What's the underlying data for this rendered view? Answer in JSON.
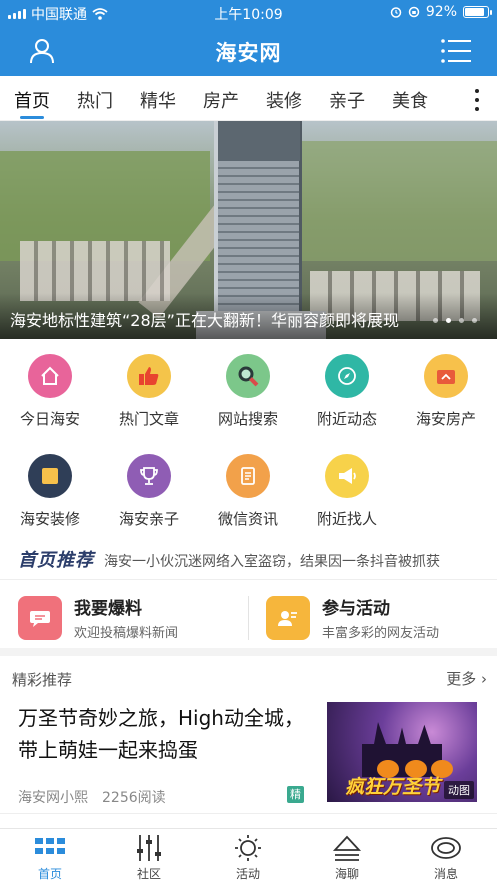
{
  "status_bar": {
    "carrier": "中国联通",
    "time": "上午10:09",
    "battery": "92%",
    "battery_level": 0.92
  },
  "header": {
    "title": "海安网",
    "left_icon": "user-icon",
    "right_icon": "menu-icon"
  },
  "tabs": [
    {
      "label": "首页",
      "active": true
    },
    {
      "label": "热门"
    },
    {
      "label": "精华"
    },
    {
      "label": "房产"
    },
    {
      "label": "装修"
    },
    {
      "label": "亲子"
    },
    {
      "label": "美食"
    }
  ],
  "banner": {
    "caption": "海安地标性建筑“28层”正在大翻新！华丽容颜即将展现",
    "slides": 4,
    "active_slide": 1
  },
  "grid": [
    {
      "label": "今日海安",
      "icon": "home-icon",
      "color": "#e8649a"
    },
    {
      "label": "热门文章",
      "icon": "thumbs-up-icon",
      "color": "#f4c44a"
    },
    {
      "label": "网站搜索",
      "icon": "search-icon",
      "color": "#7cc78a"
    },
    {
      "label": "附近动态",
      "icon": "compass-icon",
      "color": "#2fb7a5"
    },
    {
      "label": "海安房产",
      "icon": "house-card-icon",
      "color": "#f7c14b"
    },
    {
      "label": "海安装修",
      "icon": "box-icon",
      "color": "#2f3e57"
    },
    {
      "label": "海安亲子",
      "icon": "trophy-icon",
      "color": "#8f5db4"
    },
    {
      "label": "微信资讯",
      "icon": "document-icon",
      "color": "#f2a14a"
    },
    {
      "label": "附近找人",
      "icon": "megaphone-icon",
      "color": "#f7d24a"
    }
  ],
  "ticker": {
    "tag": "首页推荐",
    "text": "海安一小伙沉迷网络入室盗窃，结果因一条抖音被抓获"
  },
  "actions": [
    {
      "title": "我要爆料",
      "subtitle": "欢迎投稿爆料新闻",
      "icon": "chat-bubble-icon",
      "color": "#f0717b"
    },
    {
      "title": "参与活动",
      "subtitle": "丰富多彩的网友活动",
      "icon": "user-card-icon",
      "color": "#f6b63c"
    }
  ],
  "recommend": {
    "title": "精彩推荐",
    "more": "更多",
    "article": {
      "title": "万圣节奇妙之旅，High动全城，带上萌娃一起来捣蛋",
      "author": "海安网小熙",
      "reads": "2256阅读",
      "badge": "精",
      "thumb_text": "疯狂万圣节",
      "thumb_label": "动图"
    }
  },
  "tabbar": [
    {
      "label": "首页",
      "icon": "home-grid-icon",
      "active": true
    },
    {
      "label": "社区",
      "icon": "sliders-icon"
    },
    {
      "label": "活动",
      "icon": "sun-icon"
    },
    {
      "label": "海聊",
      "icon": "eject-icon"
    },
    {
      "label": "消息",
      "icon": "message-icon"
    }
  ],
  "colors": {
    "brand_blue": "#2b8cdb"
  }
}
